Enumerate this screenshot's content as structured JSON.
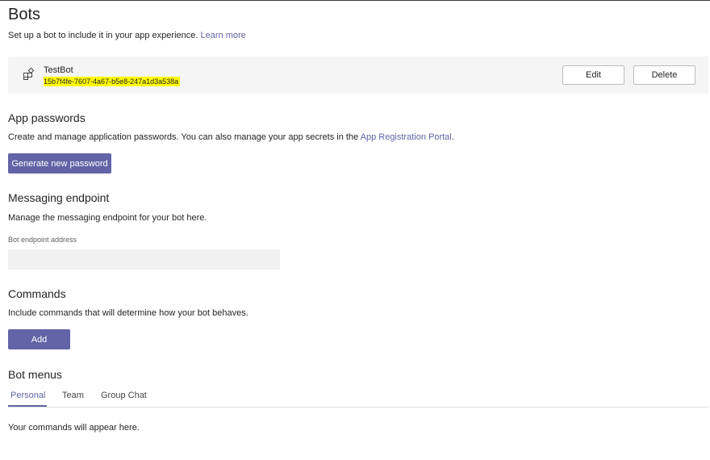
{
  "header": {
    "title": "Bots",
    "subtitle": "Set up a bot to include it in your app experience.",
    "learn_more": "Learn more"
  },
  "bot": {
    "icon": "bot-apps-icon",
    "name": "TestBot",
    "id": "15b7f4fe-7607-4a67-b5e8-247a1d3a538a",
    "edit_label": "Edit",
    "delete_label": "Delete"
  },
  "app_passwords": {
    "title": "App passwords",
    "description": "Create and manage application passwords. You can also manage your app secrets in the",
    "link": "App Registration Portal",
    "suffix": ".",
    "button": "Generate new password"
  },
  "messaging_endpoint": {
    "title": "Messaging endpoint",
    "description": "Manage the messaging endpoint for your bot here.",
    "field_label": "Bot endpoint address",
    "field_value": ""
  },
  "commands": {
    "title": "Commands",
    "description": "Include commands that will determine how your bot behaves.",
    "button": "Add"
  },
  "bot_menus": {
    "title": "Bot menus",
    "tabs": [
      "Personal",
      "Team",
      "Group Chat"
    ],
    "active_tab": "Personal",
    "empty_message": "Your commands will appear here."
  },
  "colors": {
    "accent": "#6264a7",
    "highlight": "#fffb00",
    "card_background": "#f5f5f5"
  }
}
